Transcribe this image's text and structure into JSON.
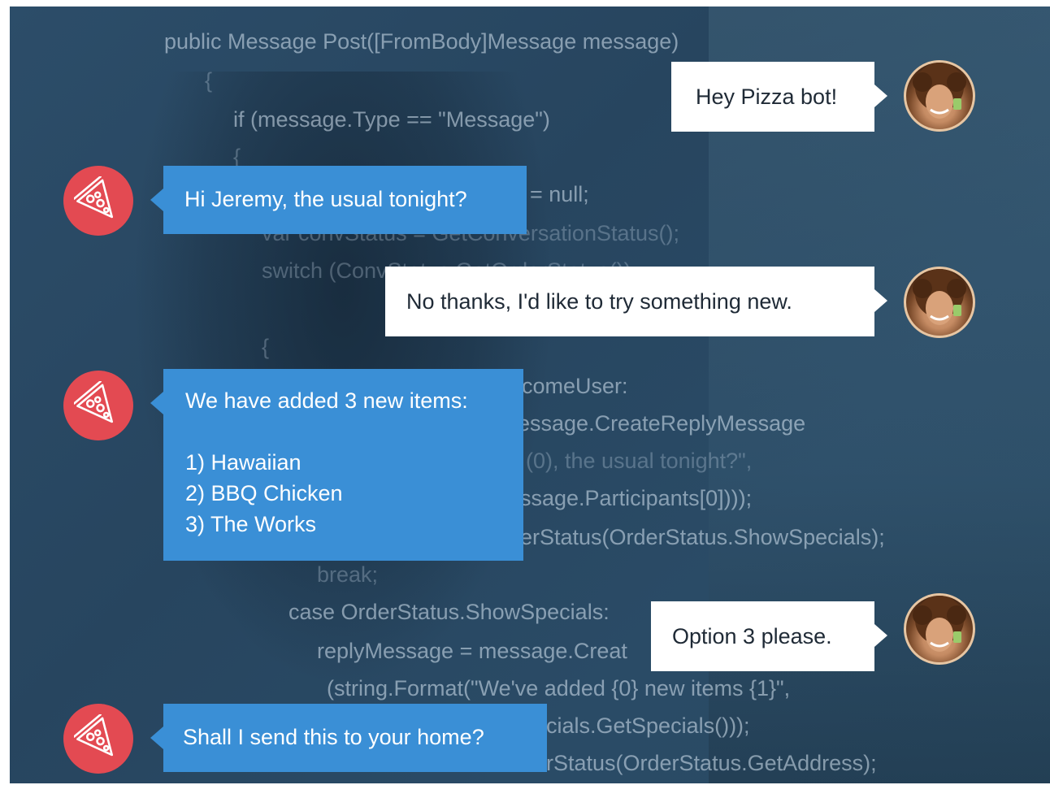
{
  "code_lines": [
    "public Message Post([FromBody]Message message)",
    "{",
    "if (message.Type == \"Message\")",
    "{",
    "= null;",
    "var convStatus = GetConversationStatus();",
    "switch (ConvStatus.GetOrderStatus())",
    "{",
    "comeUser:",
    "essage.CreateReplyMessage",
    "(0), the usual tonight?\",",
    "ssage.Participants[0])));",
    "erStatus(OrderStatus.ShowSpecials);",
    "break;",
    "case OrderStatus.ShowSpecials:",
    "replyMessage = message.Creat",
    "(string.Format(\"We've added {0} new items {1}\",",
    "cials.GetSpecials()));",
    "rStatus(OrderStatus.GetAddress);"
  ],
  "chat": {
    "user_msg_1": "Hey Pizza bot!",
    "bot_msg_1": "Hi Jeremy, the usual tonight?",
    "user_msg_2": "No thanks, I'd like to try something new.",
    "bot_msg_2": {
      "intro": "We have added 3 new items:",
      "items": [
        "1) Hawaiian",
        "2) BBQ Chicken",
        "3) The Works"
      ]
    },
    "user_msg_3": "Option 3 please.",
    "bot_msg_3": "Shall I send this to your home?"
  },
  "icons": {
    "bot_avatar": "pizza-slice-icon",
    "user_avatar": "user-photo-avatar"
  },
  "colors": {
    "bot_avatar_bg": "#e34a52",
    "bot_bubble_bg": "#3a8fd6",
    "user_bubble_bg": "#ffffff",
    "background": "#2c4d69"
  }
}
